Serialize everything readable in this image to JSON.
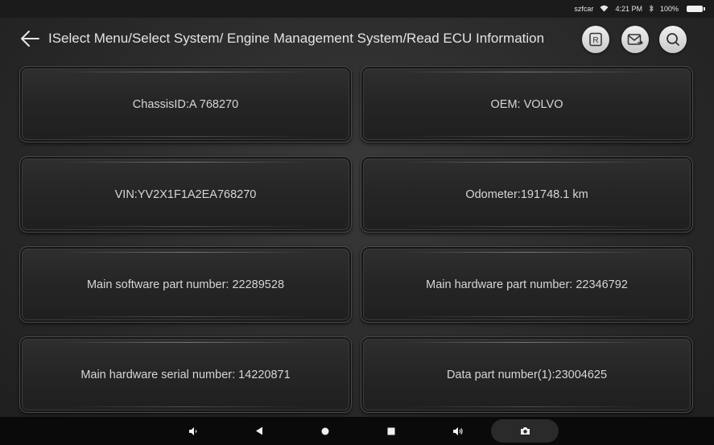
{
  "status_bar": {
    "carrier": "szfcar",
    "time": "4:21 PM",
    "battery": "100%"
  },
  "header": {
    "title": "ISelect Menu/Select System/ Engine Management System/Read ECU Information",
    "buttons": [
      {
        "icon": "report-icon",
        "glyph": "R"
      },
      {
        "icon": "mail-icon"
      },
      {
        "icon": "search-icon"
      }
    ]
  },
  "info": {
    "items": [
      {
        "label": "ChassisID:A 768270"
      },
      {
        "label": "OEM: VOLVO"
      },
      {
        "label": "VIN:YV2X1F1A2EA768270"
      },
      {
        "label": "Odometer:191748.1 km"
      },
      {
        "label": "Main software part number: 22289528"
      },
      {
        "label": "Main hardware part number: 22346792"
      },
      {
        "label": "Main hardware serial number: 14220871"
      },
      {
        "label": "Data part number(1):23004625"
      }
    ]
  },
  "nav_bar": {
    "buttons": [
      "volume-down-icon",
      "back-triangle-icon",
      "home-circle-icon",
      "recents-square-icon",
      "volume-up-icon",
      "camera-icon"
    ]
  },
  "colors": {
    "background": "#2b2b2b",
    "card": "#262626",
    "text": "#d6d6d6",
    "header_button": "#e0e0e0"
  }
}
